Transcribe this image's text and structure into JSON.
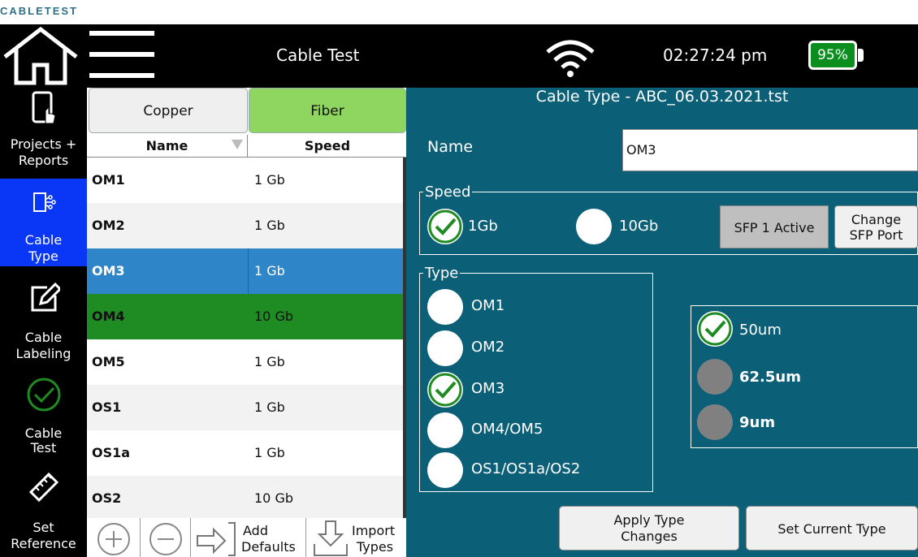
{
  "caption": "CABLETEST",
  "header": {
    "title": "Cable Test",
    "time": "02:27:24 pm",
    "battery": "95%",
    "icons": [
      "home-icon",
      "menu-icon",
      "wifi-icon",
      "battery-icon"
    ]
  },
  "nav": {
    "items": [
      {
        "label": "Projects + Reports",
        "icon": "projects-icon"
      },
      {
        "label": "Cable Type",
        "icon": "cable-type-icon",
        "active": true
      },
      {
        "label": "Cable Labeling",
        "icon": "edit-icon"
      },
      {
        "label": "Cable Test",
        "icon": "check-circle-icon"
      },
      {
        "label": "Set Reference",
        "icon": "ruler-icon"
      }
    ],
    "labels_split": [
      [
        "Projects +",
        "Reports"
      ],
      [
        "Cable",
        "Type"
      ],
      [
        "Cable",
        "Labeling"
      ],
      [
        "Cable",
        "Test"
      ],
      [
        "Set",
        "Reference"
      ]
    ]
  },
  "list": {
    "tabs": {
      "copper": "Copper",
      "fiber": "Fiber"
    },
    "columns": {
      "name": "Name",
      "speed": "Speed"
    },
    "rows": [
      {
        "name": "OM1",
        "speed": "1 Gb"
      },
      {
        "name": "OM2",
        "speed": "1 Gb"
      },
      {
        "name": "OM3",
        "speed": "1 Gb"
      },
      {
        "name": "OM4",
        "speed": "10 Gb"
      },
      {
        "name": "OM5",
        "speed": "1 Gb"
      },
      {
        "name": "OS1",
        "speed": "1 Gb"
      },
      {
        "name": "OS1a",
        "speed": "1 Gb"
      },
      {
        "name": "OS2",
        "speed": "10 Gb"
      }
    ],
    "toolbar": {
      "add_defaults": [
        "Add",
        "Defaults"
      ],
      "import_types": [
        "Import",
        "Types"
      ]
    }
  },
  "editor": {
    "title": "Cable Type - ABC_06.03.2021.tst",
    "name_label": "Name",
    "name_value": "OM3",
    "speed_legend": "Speed",
    "speed_options": [
      "1Gb",
      "10Gb"
    ],
    "sfp_status": "SFP 1 Active",
    "change_sfp": [
      "Change",
      "SFP Port"
    ],
    "type_legend": "Type",
    "type_options": [
      "OM1",
      "OM2",
      "OM3",
      "OM4/OM5",
      "OS1/OS1a/OS2"
    ],
    "core_options": [
      "50um",
      "62.5um",
      "9um"
    ],
    "apply_changes": [
      "Apply Type",
      "Changes"
    ],
    "set_current": "Set Current Type"
  },
  "colors": {
    "panel": "#0b6078",
    "selected_row": "#2e85c7",
    "highlight_row": "#1e8b23",
    "fiber_tab": "#8ed65f",
    "nav_active": "#0a36f5",
    "battery": "#0a8f1e",
    "check": "#1e8b23"
  }
}
